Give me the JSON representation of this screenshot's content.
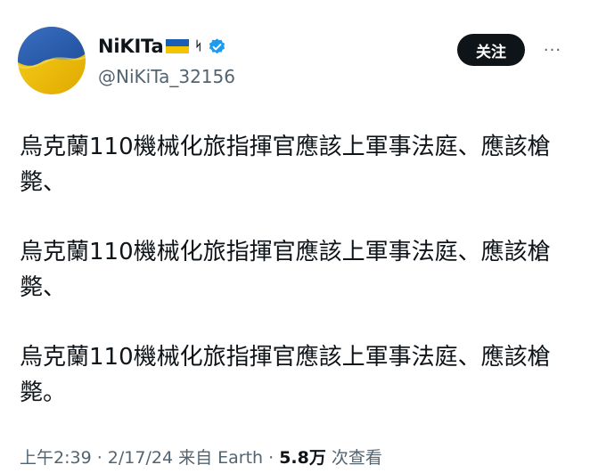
{
  "author": {
    "display_name": "NiKITa",
    "flag_icon": "ukraine-flag-icon",
    "tag_glyph": "ᛋ",
    "verified_icon": "verified-badge-icon",
    "verified_color": "#1d9bf0",
    "handle": "@NiKiTa_32156"
  },
  "actions": {
    "follow_label": "关注",
    "more_glyph": "···"
  },
  "tweet": {
    "paragraphs": [
      "烏克蘭110機械化旅指揮官應該上軍事法庭、應該槍斃、",
      "烏克蘭110機械化旅指揮官應該上軍事法庭、應該槍斃、",
      "烏克蘭110機械化旅指揮官應該上軍事法庭、應該槍斃。"
    ]
  },
  "meta": {
    "time": "上午2:39",
    "sep1": " · ",
    "date": "2/17/24",
    "source": " 来自 Earth",
    "sep2": " · ",
    "views_count": "5.8万",
    "views_label": " 次查看"
  },
  "colors": {
    "flag_blue": "#1a5fb4",
    "flag_yellow": "#f5c400"
  }
}
